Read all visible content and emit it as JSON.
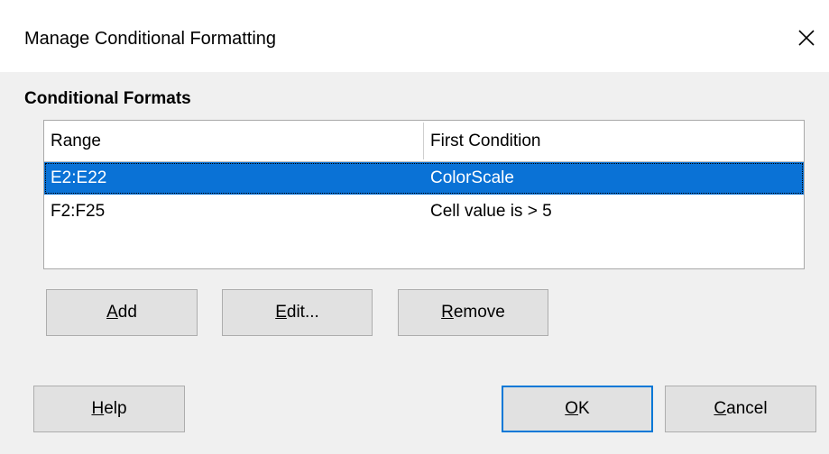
{
  "window": {
    "title": "Manage Conditional Formatting"
  },
  "section": {
    "label": "Conditional Formats"
  },
  "table": {
    "columns": [
      "Range",
      "First Condition"
    ],
    "rows": [
      {
        "range": "E2:E22",
        "condition": "ColorScale",
        "selected": true
      },
      {
        "range": "F2:F25",
        "condition": "Cell value is > 5",
        "selected": false
      }
    ]
  },
  "buttons": {
    "add": {
      "mnemonic": "A",
      "rest": "dd"
    },
    "edit": {
      "mnemonic": "E",
      "rest": "dit..."
    },
    "remove": {
      "mnemonic": "R",
      "rest": "emove"
    },
    "help": {
      "mnemonic": "H",
      "rest": "elp"
    },
    "ok": {
      "mnemonic": "O",
      "rest": "K"
    },
    "cancel": {
      "mnemonic": "C",
      "rest": "ancel"
    }
  },
  "colors": {
    "selection": "#0a72d6",
    "default_button_border": "#0078d7"
  }
}
